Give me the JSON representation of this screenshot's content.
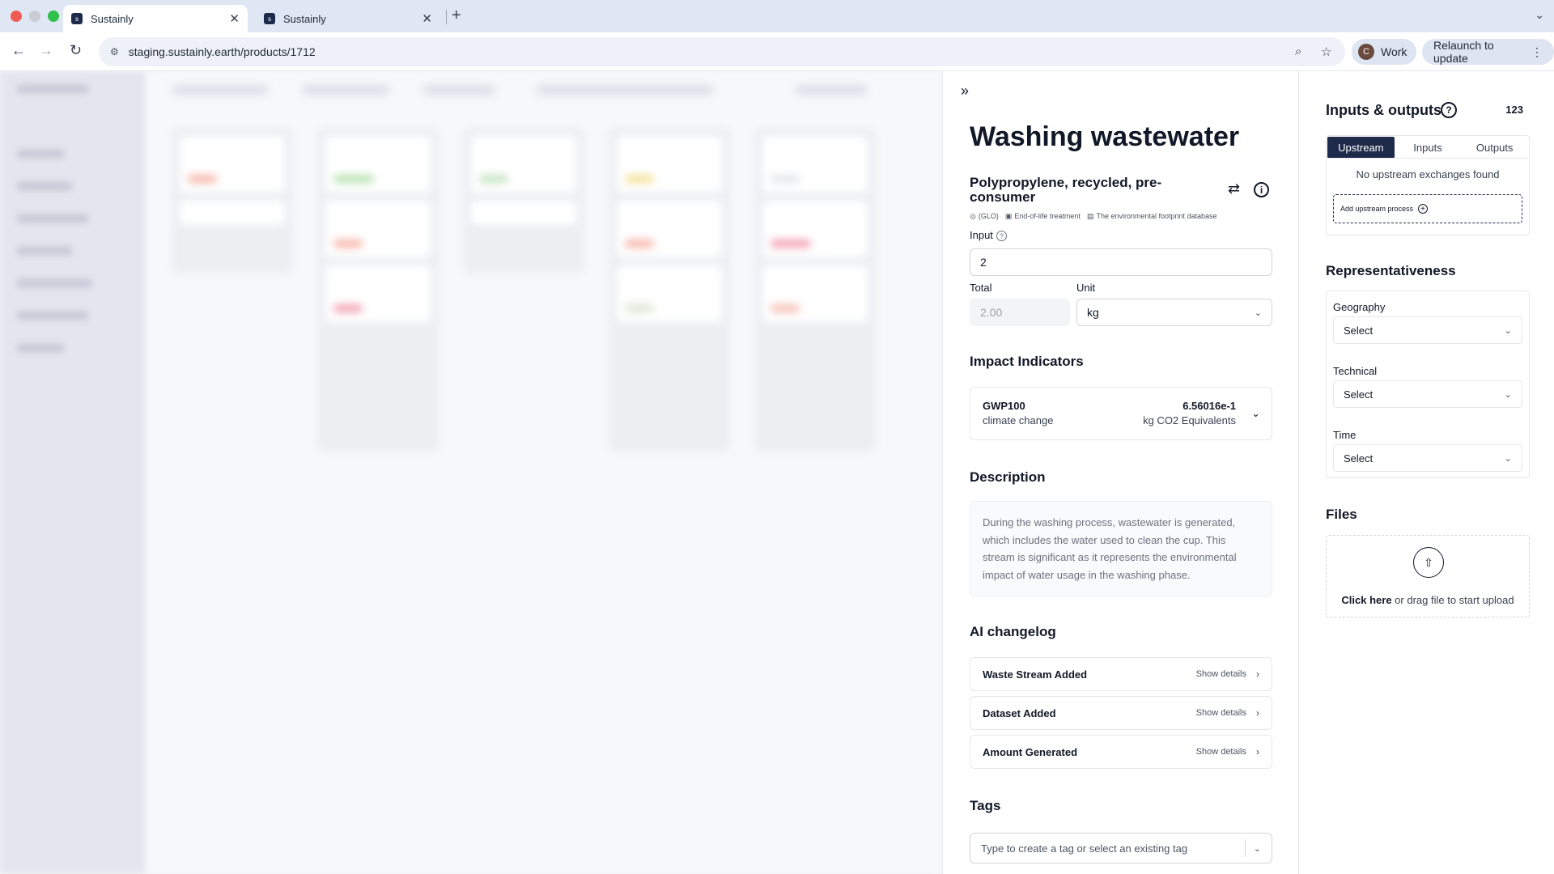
{
  "browser": {
    "tabs": [
      {
        "title": "Sustainly",
        "active": true
      },
      {
        "title": "Sustainly",
        "active": false
      }
    ],
    "url": "staging.sustainly.earth/products/1712",
    "profile_initial": "C",
    "profile_label": "Work",
    "relaunch_label": "Relaunch to update"
  },
  "panel": {
    "title": "Washing wastewater",
    "subtitle": "Polypropylene, recycled, pre-consumer",
    "meta": [
      "(GLO)",
      "End-of-life treatment",
      "The environmental footprint database"
    ],
    "input_label": "Input",
    "input_value": "2",
    "total_label": "Total",
    "total_value": "2.00",
    "unit_label": "Unit",
    "unit_value": "kg",
    "impact_heading": "Impact Indicators",
    "impact": {
      "code": "GWP100",
      "category": "climate change",
      "value": "6.56016e-1",
      "unit": "kg CO2 Equivalents"
    },
    "description_heading": "Description",
    "description": "During the washing process, wastewater is generated, which includes the water used to clean the cup. This stream is significant as it represents the environmental impact of water usage in the washing phase.",
    "changelog_heading": "AI changelog",
    "changelog": [
      {
        "title": "Waste Stream Added",
        "action": "Show details"
      },
      {
        "title": "Dataset Added",
        "action": "Show details"
      },
      {
        "title": "Amount Generated",
        "action": "Show details"
      }
    ],
    "tags_heading": "Tags",
    "tags_placeholder": "Type to create a tag or select an existing tag"
  },
  "right": {
    "io_title": "Inputs & outputs",
    "io_count": "123",
    "io_tabs": [
      "Upstream",
      "Inputs",
      "Outputs"
    ],
    "io_empty": "No upstream exchanges found",
    "add_upstream": "Add upstream process",
    "rep_title": "Representativeness",
    "geography_label": "Geography",
    "geography_value": "Select",
    "technical_label": "Technical",
    "technical_value": "Select",
    "time_label": "Time",
    "time_value": "Select",
    "files_title": "Files",
    "upload_link": "Click here",
    "upload_rest": " or drag file to start upload"
  },
  "colors": {
    "accent": "#1e2a4a",
    "chrome": "#dfe6f4"
  }
}
